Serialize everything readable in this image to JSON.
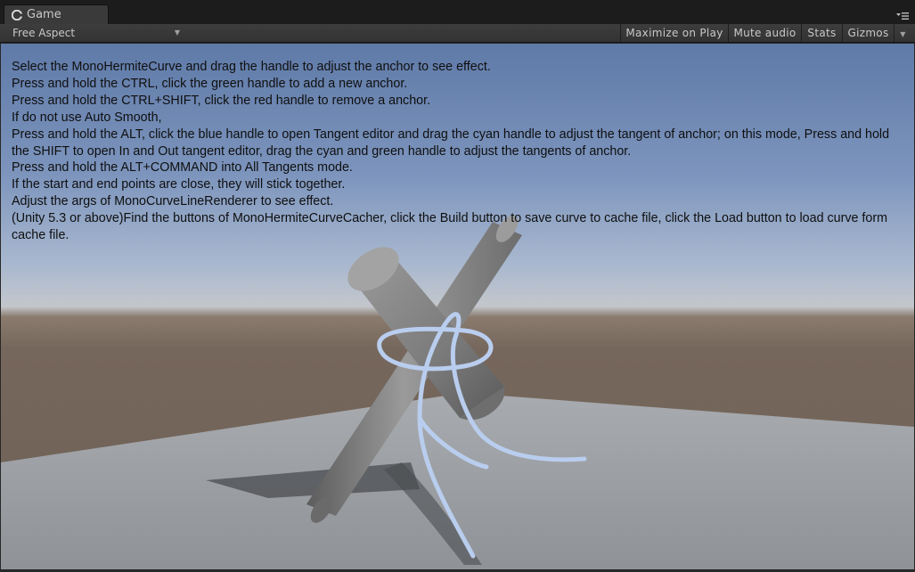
{
  "tab": {
    "title": "Game",
    "icon": "unity-icon"
  },
  "toolbar": {
    "aspect": "Free Aspect",
    "maximize_label": "Maximize on Play",
    "mute_label": "Mute audio",
    "stats_label": "Stats",
    "gizmos_label": "Gizmos"
  },
  "instructions": [
    "Select the MonoHermiteCurve and drag the handle to adjust the anchor to see effect.",
    "Press and hold the CTRL, click the green handle to add a new anchor.",
    "Press and hold the CTRL+SHIFT, click the red handle to remove a anchor.",
    "If do not use Auto Smooth,",
    "Press and hold the ALT, click the blue handle to open Tangent editor and drag the cyan handle to adjust the tangent of anchor; on this mode, Press and hold the SHIFT to open In and Out tangent editor, drag the cyan and green handle to adjust the tangents of anchor.",
    "Press and hold the ALT+COMMAND into All Tangents mode.",
    "If the start and end points are close, they will stick together.",
    "Adjust the args of MonoCurveLineRenderer to see effect.",
    "(Unity 5.3 or above)Find the buttons of MonoHermiteCurveCacher, click the Build button to save curve to cache file, click the Load button to load curve form cache file."
  ],
  "colors": {
    "sky_top": "#5f7aa8",
    "horizon": "#c3c7cc",
    "ground": "#76675c",
    "curve": "#b8cdef",
    "cylinder": "#8c8c8c"
  }
}
